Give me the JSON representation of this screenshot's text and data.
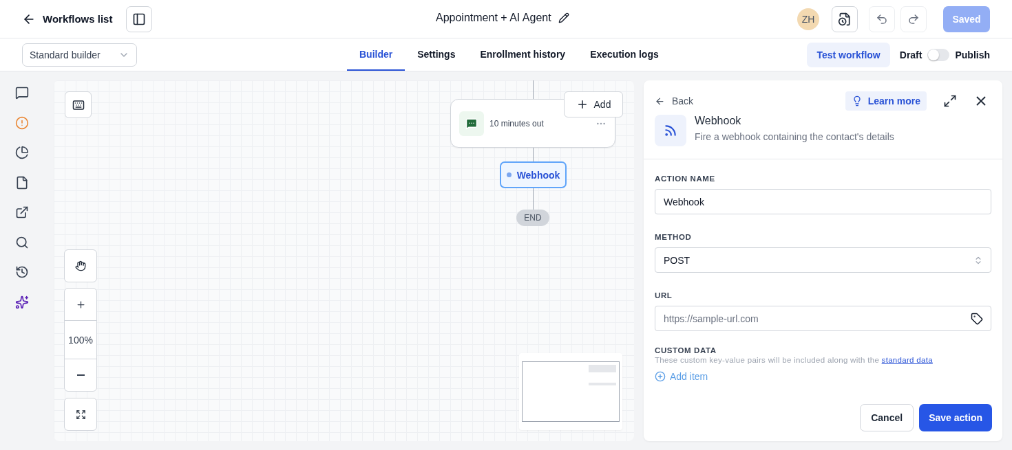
{
  "header": {
    "back_label": "Workflows list",
    "title": "Appointment + AI Agent",
    "avatar": "ZH",
    "saved_button": {
      "label": "Saved",
      "disabled": true
    }
  },
  "subbar": {
    "builder_select": "Standard builder",
    "tabs": [
      {
        "label": "Builder",
        "selected": true
      },
      {
        "label": "Settings",
        "selected": false
      },
      {
        "label": "Enrollment history",
        "selected": false
      },
      {
        "label": "Execution logs",
        "selected": false
      }
    ],
    "test_button": "Test workflow",
    "draft_label": "Draft",
    "publish": {
      "label": "Publish",
      "on": false
    }
  },
  "rail": {
    "items": [
      {
        "kind": "chat"
      },
      {
        "kind": "alert"
      },
      {
        "kind": "pie"
      },
      {
        "kind": "file"
      },
      {
        "kind": "external"
      },
      {
        "kind": "search"
      },
      {
        "kind": "history"
      },
      {
        "kind": "sparkle"
      }
    ]
  },
  "canvas": {
    "message_node": {
      "label": "10 minutes out"
    },
    "add_button": "Add",
    "webhook_node": {
      "label": "Webhook",
      "selected": true
    },
    "end_node": "END",
    "zoom": "100%"
  },
  "panel": {
    "back": "Back",
    "learn_more": "Learn more",
    "title": "Webhook",
    "description": "Fire a webhook containing the contact's details",
    "fields": [
      {
        "kind": "text",
        "label": "ACTION NAME",
        "value": "Webhook"
      },
      {
        "kind": "select",
        "label": "METHOD",
        "value": "POST"
      },
      {
        "kind": "tagged",
        "label": "URL",
        "placeholder": "https://sample-url.com"
      }
    ],
    "custom_data": {
      "label": "CUSTOM DATA",
      "description": "These custom key-value pairs will be included along with the ",
      "link": "standard data",
      "add_item": "Add item"
    },
    "cancel": "Cancel",
    "save": "Save action"
  }
}
